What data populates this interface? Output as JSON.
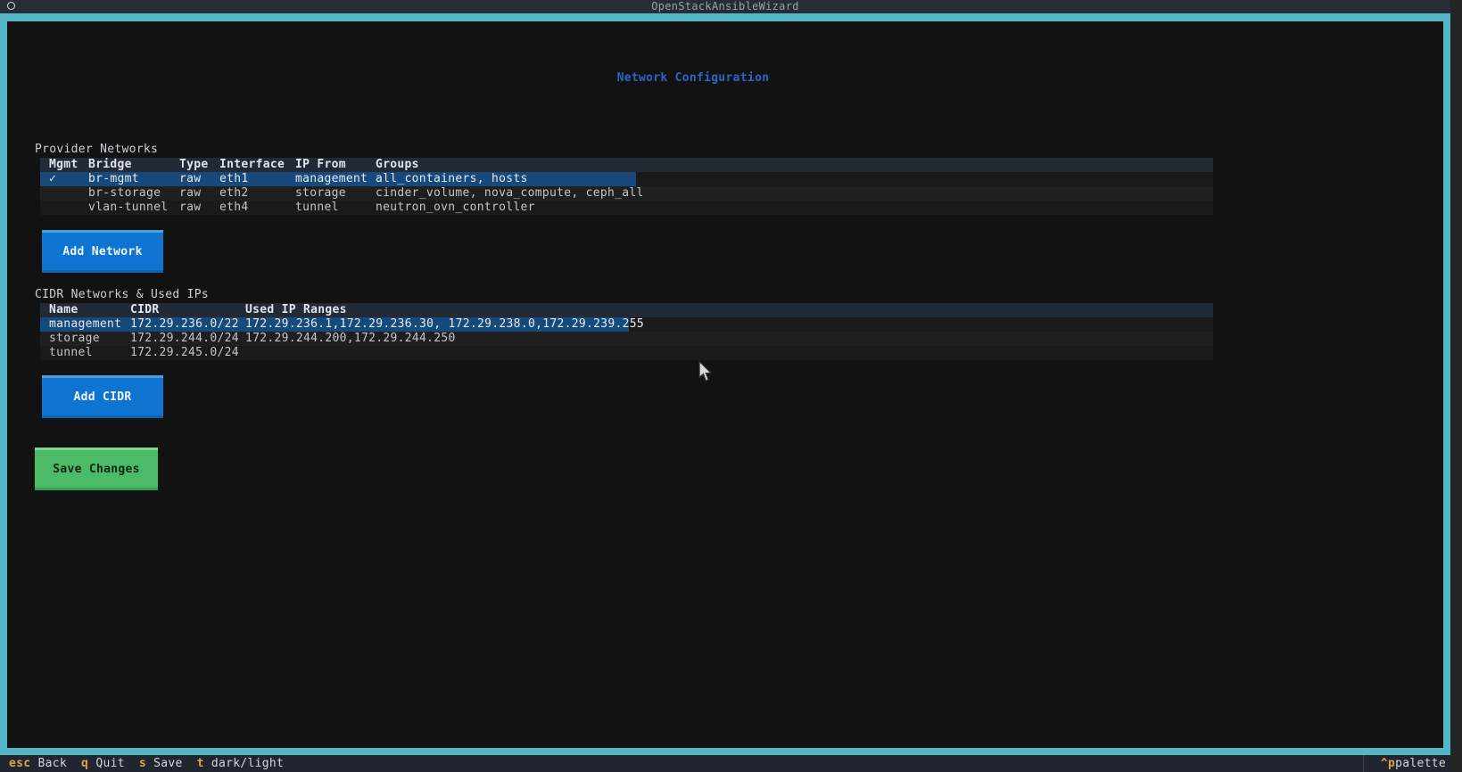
{
  "window": {
    "title": "OpenStackAnsibleWizard"
  },
  "page": {
    "title": "Network Configuration"
  },
  "provider_networks": {
    "label": "Provider Networks",
    "columns": [
      "Mgmt",
      "Bridge",
      "Type",
      "Interface",
      "IP From",
      "Groups"
    ],
    "rows": [
      {
        "mgmt": "✓",
        "bridge": "br-mgmt",
        "type": "raw",
        "interface": "eth1",
        "ip_from": "management",
        "groups": "all_containers, hosts",
        "selected": true
      },
      {
        "mgmt": "",
        "bridge": "br-storage",
        "type": "raw",
        "interface": "eth2",
        "ip_from": "storage",
        "groups": "cinder_volume, nova_compute, ceph_all",
        "selected": false
      },
      {
        "mgmt": "",
        "bridge": "vlan-tunnel",
        "type": "raw",
        "interface": "eth4",
        "ip_from": "tunnel",
        "groups": "neutron_ovn_controller",
        "selected": false
      }
    ],
    "add_button": "Add Network"
  },
  "cidr_networks": {
    "label": "CIDR Networks & Used IPs",
    "columns": [
      "Name",
      "CIDR",
      "Used IP Ranges"
    ],
    "rows": [
      {
        "name": "management",
        "cidr": "172.29.236.0/22",
        "ranges": "172.29.236.1,172.29.236.30, 172.29.238.0,172.29.239.255",
        "selected": true
      },
      {
        "name": "storage",
        "cidr": "172.29.244.0/24",
        "ranges": "172.29.244.200,172.29.244.250",
        "selected": false
      },
      {
        "name": "tunnel",
        "cidr": "172.29.245.0/24",
        "ranges": "",
        "selected": false
      }
    ],
    "add_button": "Add CIDR"
  },
  "save_button": "Save Changes",
  "footer": {
    "hints": [
      {
        "key": "esc",
        "label": "Back"
      },
      {
        "key": "q",
        "label": "Quit"
      },
      {
        "key": "s",
        "label": "Save"
      },
      {
        "key": "t",
        "label": "dark/light"
      }
    ],
    "palette": {
      "key": "^p",
      "label": "palette"
    }
  },
  "icons": {
    "window_control": "circle-icon",
    "selected_row_mark": "checkmark-icon",
    "pointer": "arrow-cursor"
  },
  "colors": {
    "frame_teal": "#54b7c5",
    "title_blue": "#2767c8",
    "button_blue": "#0d74d1",
    "button_green": "#4cbb67",
    "selection_blue": "#17497a",
    "header_row_bg": "#222a36",
    "footer_key_orange": "#dfa345",
    "content_bg": "#121212"
  }
}
